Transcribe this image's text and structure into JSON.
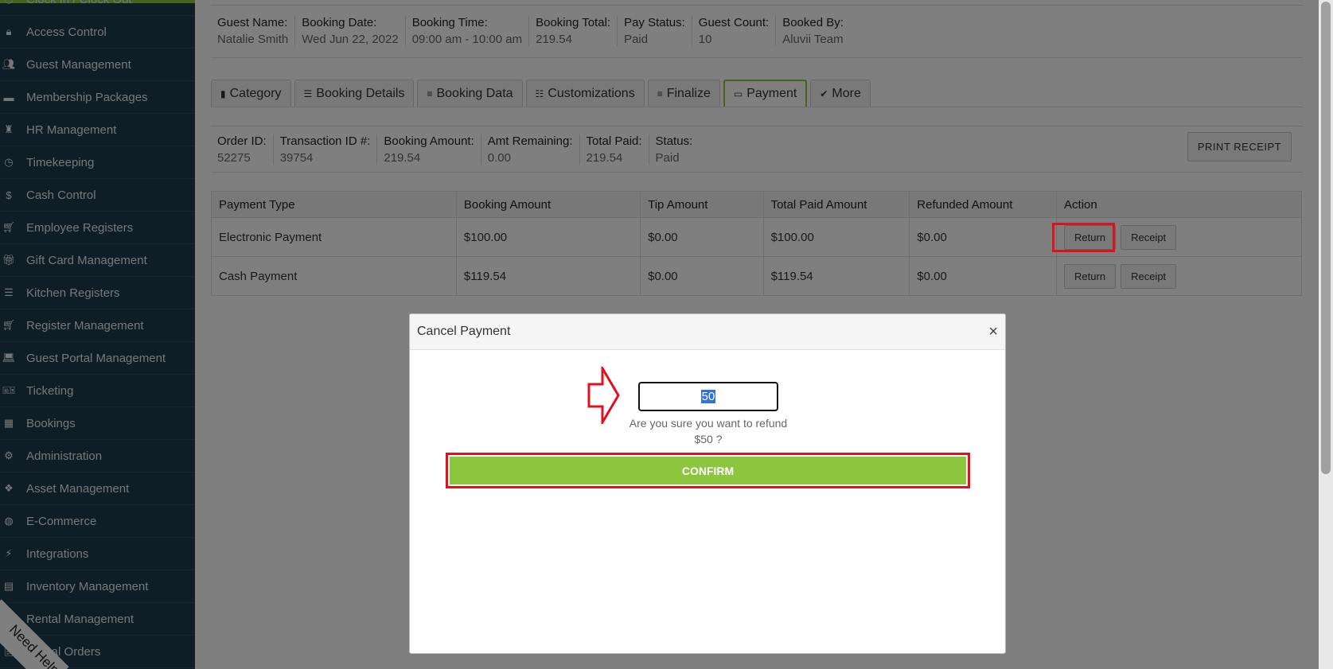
{
  "sidebar": {
    "items": [
      {
        "label": "Clock In / Clock Out",
        "icon": "clock-icon"
      },
      {
        "label": "Access Control",
        "icon": "lock-icon"
      },
      {
        "label": "Guest Management",
        "icon": "users-icon"
      },
      {
        "label": "Membership Packages",
        "icon": "card-icon"
      },
      {
        "label": "HR Management",
        "icon": "hr-icon"
      },
      {
        "label": "Timekeeping",
        "icon": "clock-icon"
      },
      {
        "label": "Cash Control",
        "icon": "dollar-icon"
      },
      {
        "label": "Employee Registers",
        "icon": "cart-icon"
      },
      {
        "label": "Gift Card Management",
        "icon": "gift-icon"
      },
      {
        "label": "Kitchen Registers",
        "icon": "list-icon"
      },
      {
        "label": "Register Management",
        "icon": "cart-icon"
      },
      {
        "label": "Guest Portal Management",
        "icon": "laptop-icon"
      },
      {
        "label": "Ticketing",
        "icon": "ticket-icon"
      },
      {
        "label": "Bookings",
        "icon": "calendar-icon"
      },
      {
        "label": "Administration",
        "icon": "gears-icon"
      },
      {
        "label": "Asset Management",
        "icon": "cubes-icon"
      },
      {
        "label": "E-Commerce",
        "icon": "globe-icon"
      },
      {
        "label": "Integrations",
        "icon": "bolt-icon"
      },
      {
        "label": "Inventory Management",
        "icon": "archive-icon"
      },
      {
        "label": "Rental Management",
        "icon": "clipboard-icon"
      },
      {
        "label": "Rental Orders",
        "icon": "clipboard-icon"
      }
    ],
    "help_label": "Need Help"
  },
  "booking_info": [
    {
      "label": "Guest Name:",
      "value": "Natalie Smith"
    },
    {
      "label": "Booking Date:",
      "value": "Wed Jun 22, 2022"
    },
    {
      "label": "Booking Time:",
      "value": "09:00 am - 10:00 am"
    },
    {
      "label": "Booking Total:",
      "value": "219.54"
    },
    {
      "label": "Pay Status:",
      "value": "Paid"
    },
    {
      "label": "Guest Count:",
      "value": "10"
    },
    {
      "label": "Booked By:",
      "value": "Aluvii Team"
    }
  ],
  "tabs": [
    {
      "label": "Category",
      "icon": "book-icon"
    },
    {
      "label": "Booking Details",
      "icon": "list-icon"
    },
    {
      "label": "Booking Data",
      "icon": "database-icon"
    },
    {
      "label": "Customizations",
      "icon": "sliders-icon"
    },
    {
      "label": "Finalize",
      "icon": "database-icon"
    },
    {
      "label": "Payment",
      "icon": "credit-card-icon",
      "active": true
    },
    {
      "label": "More",
      "icon": "check-circle-icon"
    }
  ],
  "order_info": [
    {
      "label": "Order ID:",
      "value": "52275"
    },
    {
      "label": "Transaction ID #:",
      "value": "39754"
    },
    {
      "label": "Booking Amount:",
      "value": "219.54"
    },
    {
      "label": "Amt Remaining:",
      "value": "0.00"
    },
    {
      "label": "Total Paid:",
      "value": "219.54"
    },
    {
      "label": "Status:",
      "value": "Paid"
    }
  ],
  "print_receipt_label": "PRINT RECEIPT",
  "payments": {
    "headers": [
      "Payment Type",
      "Booking Amount",
      "Tip Amount",
      "Total Paid Amount",
      "Refunded Amount",
      "Action"
    ],
    "rows": [
      {
        "type": "Electronic Payment",
        "booking": "$100.00",
        "tip": "$0.00",
        "total": "$100.00",
        "refunded": "$0.00"
      },
      {
        "type": "Cash Payment",
        "booking": "$119.54",
        "tip": "$0.00",
        "total": "$119.54",
        "refunded": "$0.00"
      }
    ],
    "return_label": "Return",
    "receipt_label": "Receipt"
  },
  "modal": {
    "title": "Cancel Payment",
    "close": "×",
    "amount": "50",
    "question_line1": "Are you sure you want to refund",
    "question_line2": "$50 ?",
    "confirm_label": "CONFIRM"
  },
  "colors": {
    "sidebar_bg": "#1f3a4d",
    "accent_green": "#8cc63f",
    "highlight_red": "#e0101e",
    "selection_blue": "#3373d9"
  }
}
